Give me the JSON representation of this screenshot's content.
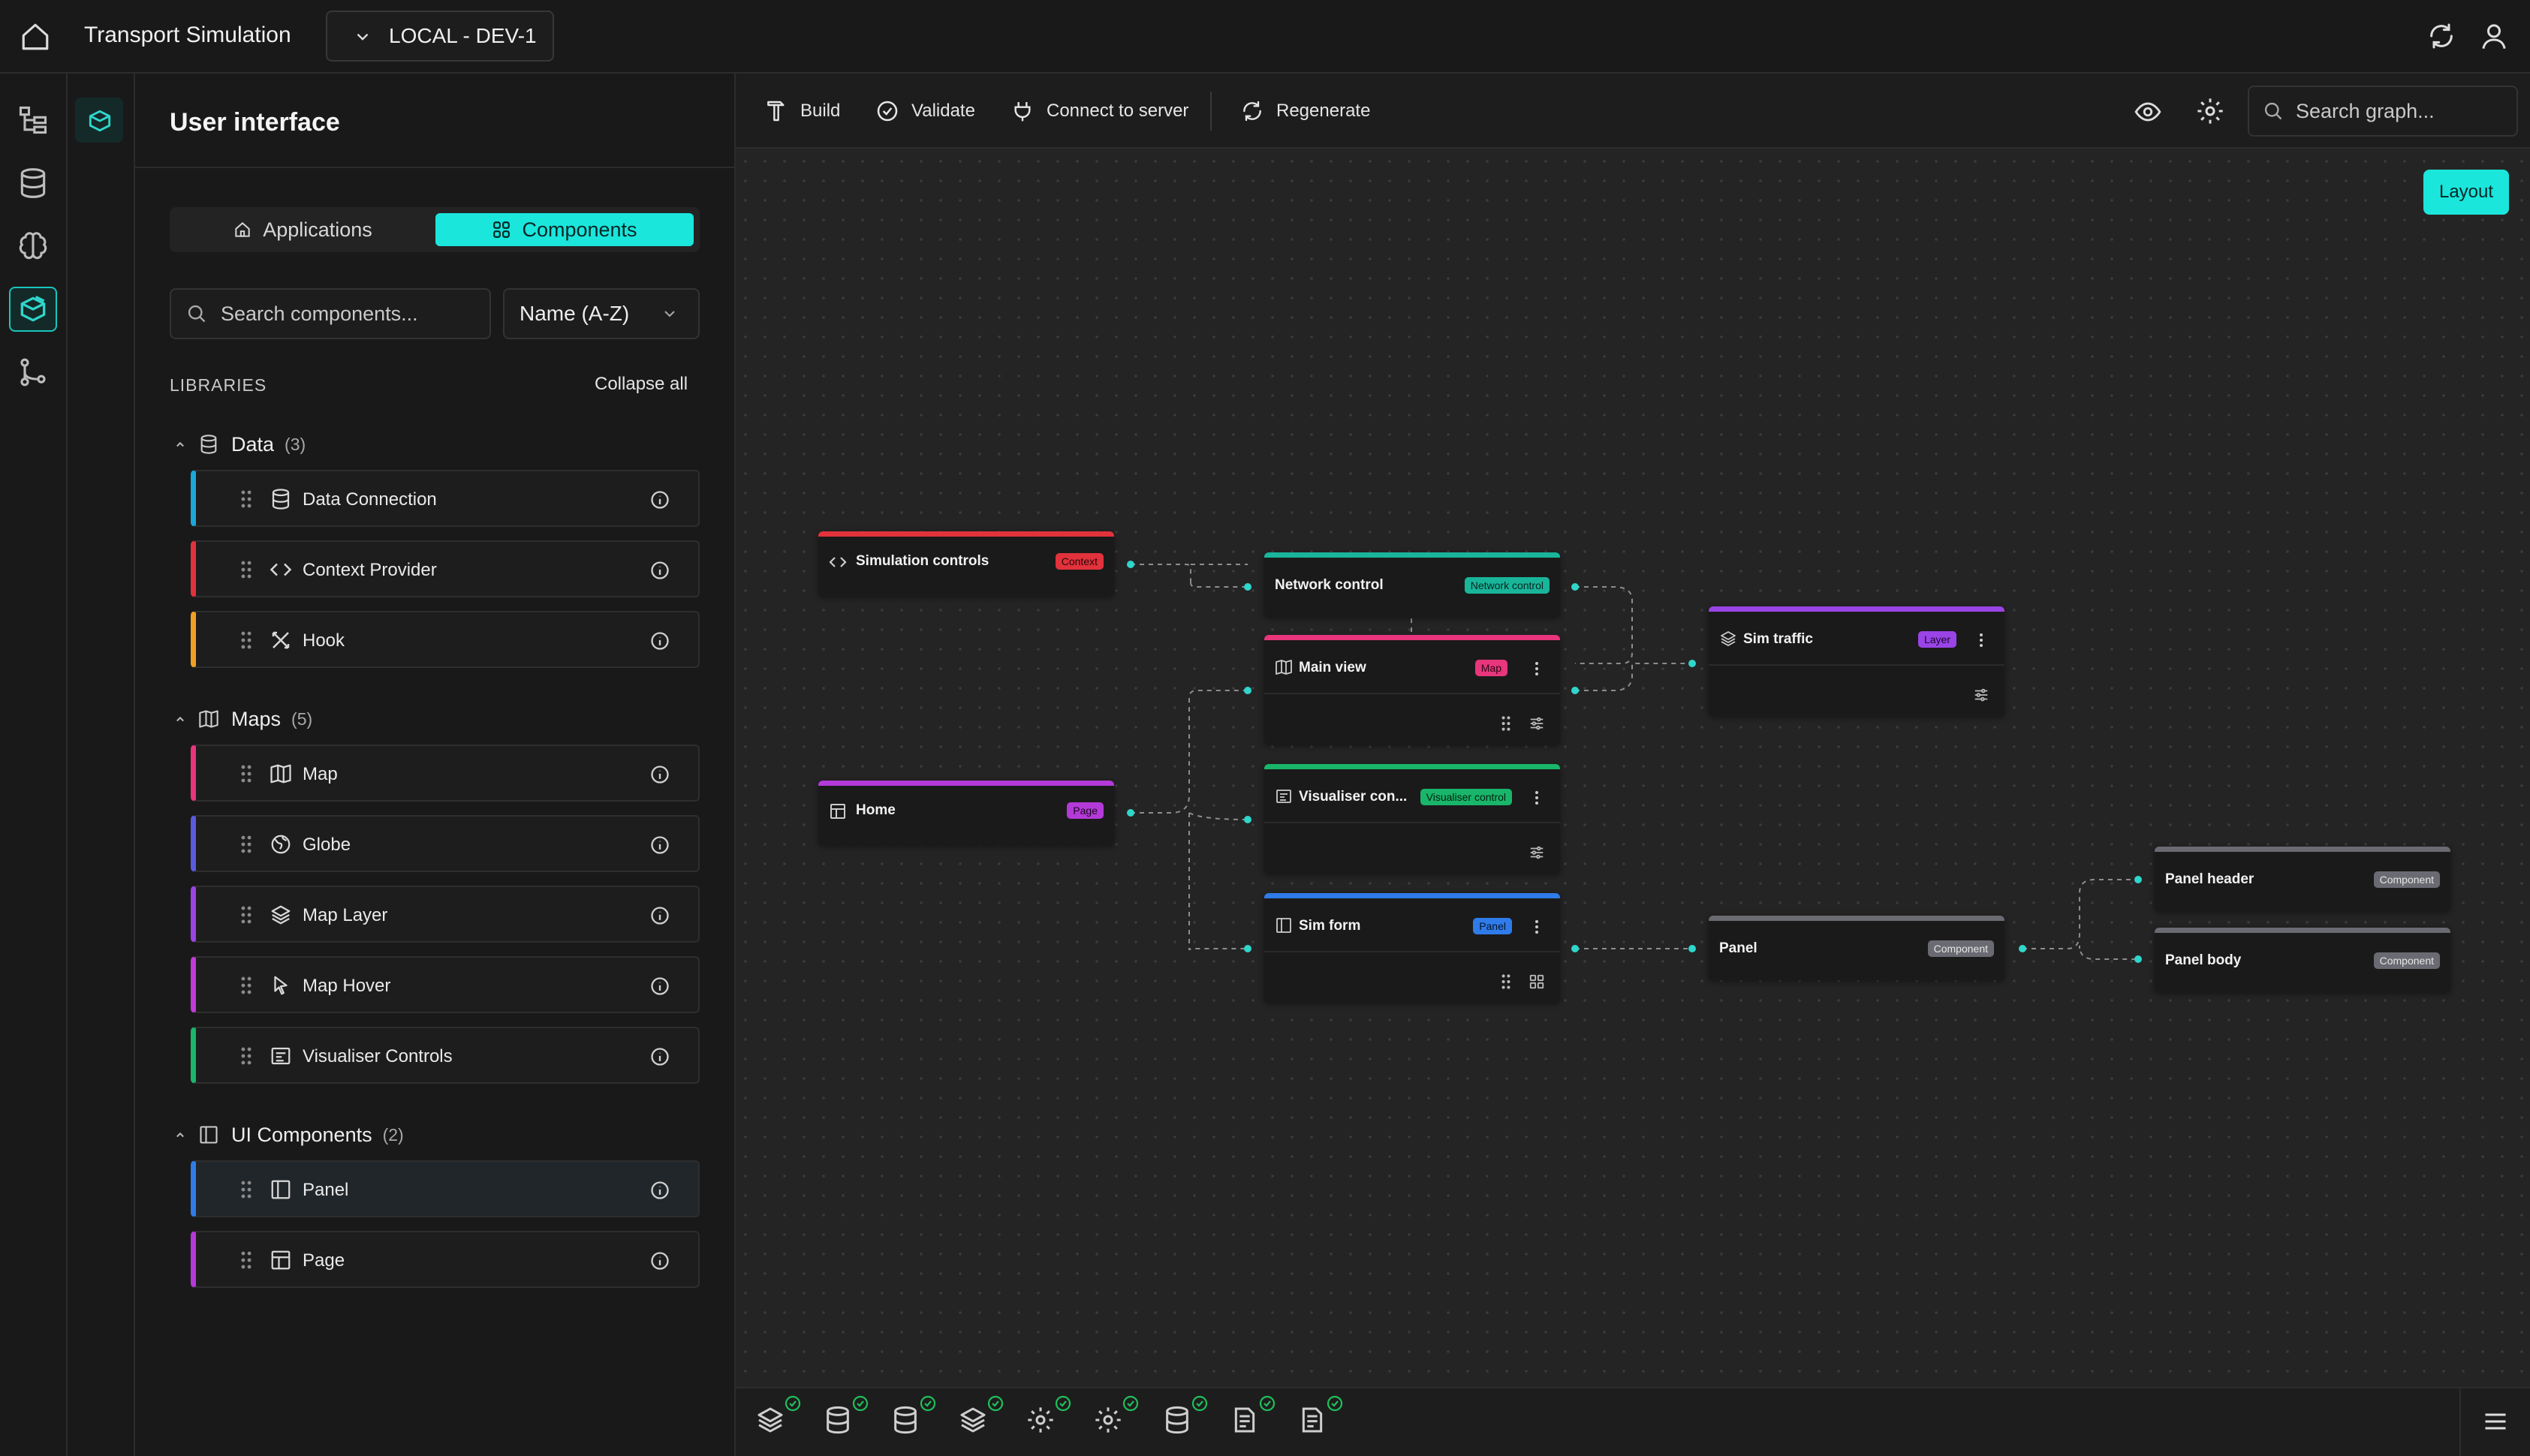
{
  "app": {
    "title": "Transport Simulation",
    "environment": "LOCAL - DEV-1"
  },
  "panel": {
    "title": "User interface",
    "tabs": [
      {
        "label": "Applications",
        "icon": "house-icon"
      },
      {
        "label": "Components",
        "icon": "grid-icon",
        "active": true
      }
    ],
    "search_placeholder": "Search components...",
    "sort_label": "Name (A-Z)",
    "libraries_label": "LIBRARIES",
    "collapse_all": "Collapse all",
    "groups": [
      {
        "name": "Data",
        "count": "(3)",
        "icon": "database-icon",
        "items": [
          {
            "label": "Data Connection",
            "icon": "database-icon",
            "color": "#1aa8d8"
          },
          {
            "label": "Context Provider",
            "icon": "code-icon",
            "color": "#e2323c"
          },
          {
            "label": "Hook",
            "icon": "tools-icon",
            "color": "#f0a020"
          }
        ]
      },
      {
        "name": "Maps",
        "count": "(5)",
        "icon": "map-icon",
        "items": [
          {
            "label": "Map",
            "icon": "map-icon",
            "color": "#e8357c"
          },
          {
            "label": "Globe",
            "icon": "globe-icon",
            "color": "#5a5ae0"
          },
          {
            "label": "Map Layer",
            "icon": "layers-icon",
            "color": "#9a44e6"
          },
          {
            "label": "Map Hover",
            "icon": "pointer-icon",
            "color": "#c23ad8"
          },
          {
            "label": "Visualiser Controls",
            "icon": "controls-icon",
            "color": "#19b56a"
          }
        ]
      },
      {
        "name": "UI Components",
        "count": "(2)",
        "icon": "panel-icon",
        "items": [
          {
            "label": "Panel",
            "icon": "panel-icon",
            "color": "#2f7bea",
            "selected": true
          },
          {
            "label": "Page",
            "icon": "page-icon",
            "color": "#b33ad8"
          }
        ]
      }
    ]
  },
  "toolbar": {
    "build": "Build",
    "validate": "Validate",
    "connect": "Connect to server",
    "regenerate": "Regenerate",
    "search_placeholder": "Search graph...",
    "layout": "Layout"
  },
  "nodes": {
    "sim_controls": {
      "title": "Simulation controls",
      "badge": "Context",
      "color": "#e2323c",
      "icon": "code-icon"
    },
    "home": {
      "title": "Home",
      "badge": "Page",
      "color": "#b33ad8",
      "icon": "page-icon"
    },
    "network_control": {
      "title": "Network control",
      "badge": "Network control",
      "color": "#19b59a"
    },
    "main_view": {
      "title": "Main view",
      "badge": "Map",
      "color": "#e8357c",
      "icon": "map-icon"
    },
    "vis_controls": {
      "title": "Visualiser con...",
      "badge": "Visualiser control",
      "color": "#19b56a",
      "icon": "controls-icon"
    },
    "sim_form": {
      "title": "Sim form",
      "badge": "Panel",
      "color": "#2f7bea",
      "icon": "panel-icon"
    },
    "sim_traffic": {
      "title": "Sim traffic",
      "badge": "Layer",
      "color": "#9a44e6",
      "icon": "layers-icon"
    },
    "panel": {
      "title": "Panel",
      "badge": "Component",
      "color": "#6a6a72"
    },
    "panel_header": {
      "title": "Panel header",
      "badge": "Component",
      "color": "#6a6a72"
    },
    "panel_body": {
      "title": "Panel body",
      "badge": "Component",
      "color": "#6a6a72"
    }
  },
  "bottom_icons": [
    "layers-icon",
    "database-icon",
    "database-icon",
    "layers-icon",
    "gear-icon",
    "gear-icon",
    "database-icon",
    "document-icon",
    "document-icon"
  ],
  "colors": {
    "accent": "#1ae6dc",
    "success": "#1fbf5c"
  }
}
